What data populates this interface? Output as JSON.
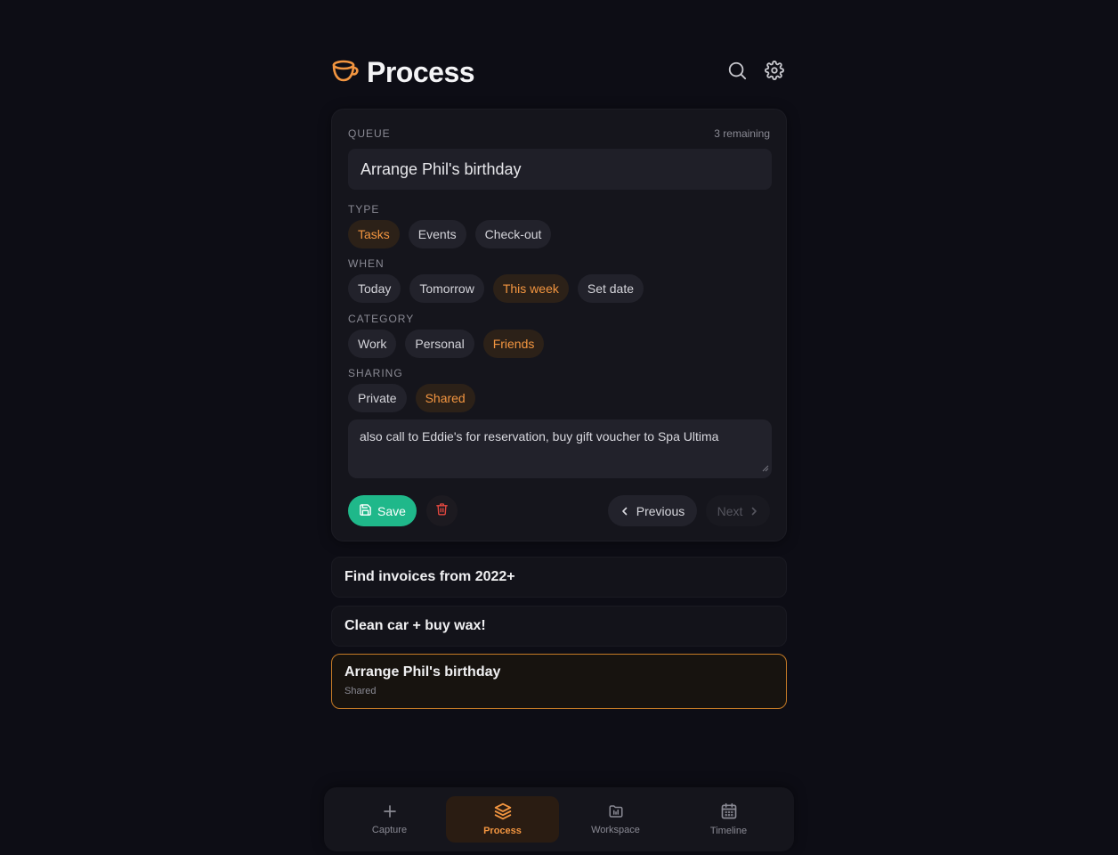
{
  "header": {
    "title": "Process",
    "logo_icon": "cup-icon",
    "search_icon": "search-icon",
    "settings_icon": "gear-icon"
  },
  "queue": {
    "label": "QUEUE",
    "remaining": "3 remaining",
    "title_value": "Arrange Phil's birthday"
  },
  "type": {
    "label": "TYPE",
    "options": [
      "Tasks",
      "Events",
      "Check-out"
    ],
    "selected": "Tasks"
  },
  "when": {
    "label": "WHEN",
    "options": [
      "Today",
      "Tomorrow",
      "This week",
      "Set date"
    ],
    "selected": "This week"
  },
  "category": {
    "label": "CATEGORY",
    "options": [
      "Work",
      "Personal",
      "Friends"
    ],
    "selected": "Friends"
  },
  "sharing": {
    "label": "SHARING",
    "options": [
      "Private",
      "Shared"
    ],
    "selected": "Shared"
  },
  "notes": {
    "value": "also call to Eddie's for reservation, buy gift voucher to Spa Ultima"
  },
  "actions": {
    "save_label": "Save",
    "previous_label": "Previous",
    "next_label": "Next"
  },
  "list": [
    {
      "title": "Find invoices from 2022+"
    },
    {
      "title": "Clean car + buy wax!"
    },
    {
      "title": "Arrange Phil's birthday",
      "subtitle": "Shared",
      "selected": true
    }
  ],
  "nav": {
    "items": [
      {
        "label": "Capture",
        "icon": "plus-icon"
      },
      {
        "label": "Process",
        "icon": "layers-icon",
        "active": true
      },
      {
        "label": "Workspace",
        "icon": "folder-chart-icon"
      },
      {
        "label": "Timeline",
        "icon": "calendar-icon"
      }
    ]
  },
  "colors": {
    "accent": "#f29540",
    "save": "#1fb88a",
    "delete": "#e0473f",
    "background": "#0d0d15"
  }
}
